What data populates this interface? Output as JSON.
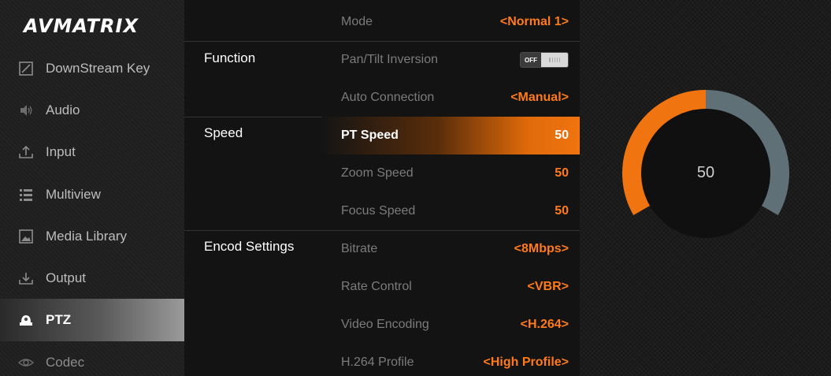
{
  "app": {
    "logo_text": "AVMATRIX"
  },
  "sidebar": {
    "items": [
      {
        "label": "DownStream Key",
        "icon": "downstream-key-icon",
        "active": false
      },
      {
        "label": "Audio",
        "icon": "speaker-icon",
        "active": false
      },
      {
        "label": "Input",
        "icon": "upload-icon",
        "active": false
      },
      {
        "label": "Multiview",
        "icon": "list-icon",
        "active": false
      },
      {
        "label": "Media Library",
        "icon": "image-icon",
        "active": false
      },
      {
        "label": "Output",
        "icon": "download-icon",
        "active": false
      },
      {
        "label": "PTZ",
        "icon": "camera-icon",
        "active": true
      },
      {
        "label": "Codec",
        "icon": "eye-icon",
        "active": false
      }
    ]
  },
  "panel": {
    "groups": [
      {
        "label": "",
        "rows": [
          {
            "label": "Mode",
            "value": "<Normal 1>"
          }
        ]
      },
      {
        "label": "Function",
        "rows": [
          {
            "label": "Pan/Tilt Inversion",
            "toggle": "OFF"
          },
          {
            "label": "Auto Connection",
            "value": "<Manual>"
          }
        ]
      },
      {
        "label": "Speed",
        "rows": [
          {
            "label": "PT Speed",
            "value": "50",
            "selected": true
          },
          {
            "label": "Zoom Speed",
            "value": "50"
          },
          {
            "label": "Focus Speed",
            "value": "50"
          }
        ]
      },
      {
        "label": "Encod Settings",
        "rows": [
          {
            "label": "Bitrate",
            "value": "<8Mbps>"
          },
          {
            "label": "Rate Control",
            "value": "<VBR>"
          },
          {
            "label": "Video Encoding",
            "value": "<H.264>"
          },
          {
            "label": "H.264 Profile",
            "value": "<High Profile>"
          }
        ]
      }
    ]
  },
  "dial": {
    "value": "50",
    "fraction": 0.5,
    "accent_color": "#f07410",
    "track_color": "#5f7177"
  },
  "colors": {
    "accent": "#ff7a1a",
    "background": "#1b1b1b",
    "panel": "#131313"
  }
}
